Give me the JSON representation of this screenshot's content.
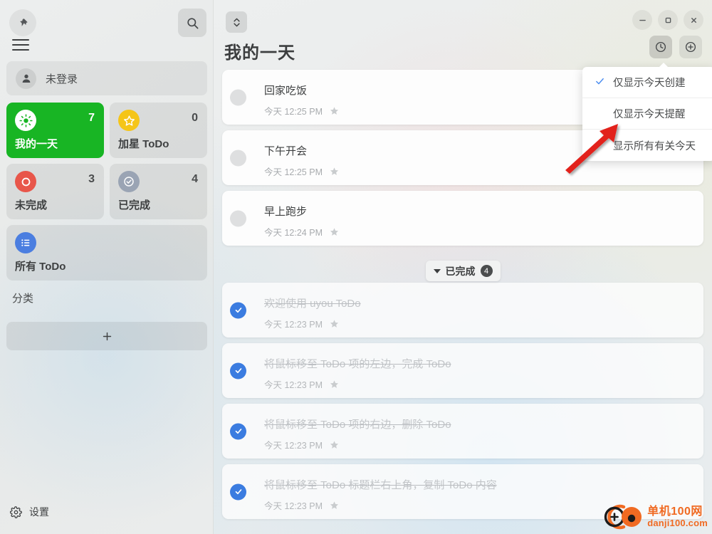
{
  "sidebar": {
    "pin_icon": "pin-icon",
    "search_icon": "search-icon",
    "menu_icon": "hamburger-icon",
    "user": {
      "name": "未登录",
      "icon": "user-icon"
    },
    "tiles": [
      {
        "label": "我的一天",
        "count": "7",
        "icon": "sun-icon",
        "color": "#18b524",
        "active": true
      },
      {
        "label": "加星 ToDo",
        "count": "0",
        "icon": "star-icon",
        "color": "#f5c518",
        "active": false
      },
      {
        "label": "未完成",
        "count": "3",
        "icon": "circle-icon",
        "color": "#e8564a",
        "active": false
      },
      {
        "label": "已完成",
        "count": "4",
        "icon": "check-circle-icon",
        "color": "#9aa4b4",
        "active": false
      },
      {
        "label": "所有 ToDo",
        "count": "",
        "icon": "list-icon",
        "color": "#4b7ee0",
        "active": false
      }
    ],
    "category_label": "分类",
    "add_category_icon": "plus-icon",
    "settings": {
      "label": "设置",
      "icon": "gear-icon"
    }
  },
  "header": {
    "sort_icon": "sort-updown-icon",
    "title": "我的一天",
    "window_controls": [
      {
        "name": "minimize",
        "icon": "minimize-icon"
      },
      {
        "name": "maximize",
        "icon": "maximize-icon"
      },
      {
        "name": "close",
        "icon": "close-icon"
      }
    ],
    "tools": [
      {
        "name": "time-filter",
        "icon": "clock-icon",
        "pressed": true
      },
      {
        "name": "add-todo",
        "icon": "plus-circle-icon",
        "pressed": false
      }
    ]
  },
  "dropdown": {
    "items": [
      {
        "label": "仅显示今天创建",
        "checked": true
      },
      {
        "label": "仅显示今天提醒",
        "checked": false
      },
      {
        "label": "显示所有有关今天",
        "checked": false
      }
    ],
    "check_icon": "check-icon"
  },
  "tasks": {
    "pending": [
      {
        "title": "回家吃饭",
        "time": "今天 12:25 PM",
        "star": "star-icon"
      },
      {
        "title": "下午开会",
        "time": "今天 12:25 PM",
        "star": "star-icon"
      },
      {
        "title": "早上跑步",
        "time": "今天 12:24 PM",
        "star": "star-icon"
      }
    ],
    "done_header": {
      "label": "已完成",
      "count": "4",
      "caret": "caret-down-icon"
    },
    "done": [
      {
        "title": "欢迎使用 uyou ToDo",
        "time": "今天 12:23 PM",
        "star": "star-icon"
      },
      {
        "title": "将鼠标移至 ToDo 项的左边，完成 ToDo",
        "time": "今天 12:23 PM",
        "star": "star-icon"
      },
      {
        "title": "将鼠标移至 ToDo 项的右边，删除 ToDo",
        "time": "今天 12:23 PM",
        "star": "star-icon"
      },
      {
        "title": "将鼠标移至 ToDo 标题栏右上角，复制 ToDo 内容",
        "time": "今天 12:23 PM",
        "star": "star-icon"
      }
    ]
  },
  "annotation": {
    "arrow": "red-arrow-pointer"
  },
  "watermark": {
    "cn": "单机100网",
    "en": "danji100.com",
    "color": "#f06a22"
  }
}
